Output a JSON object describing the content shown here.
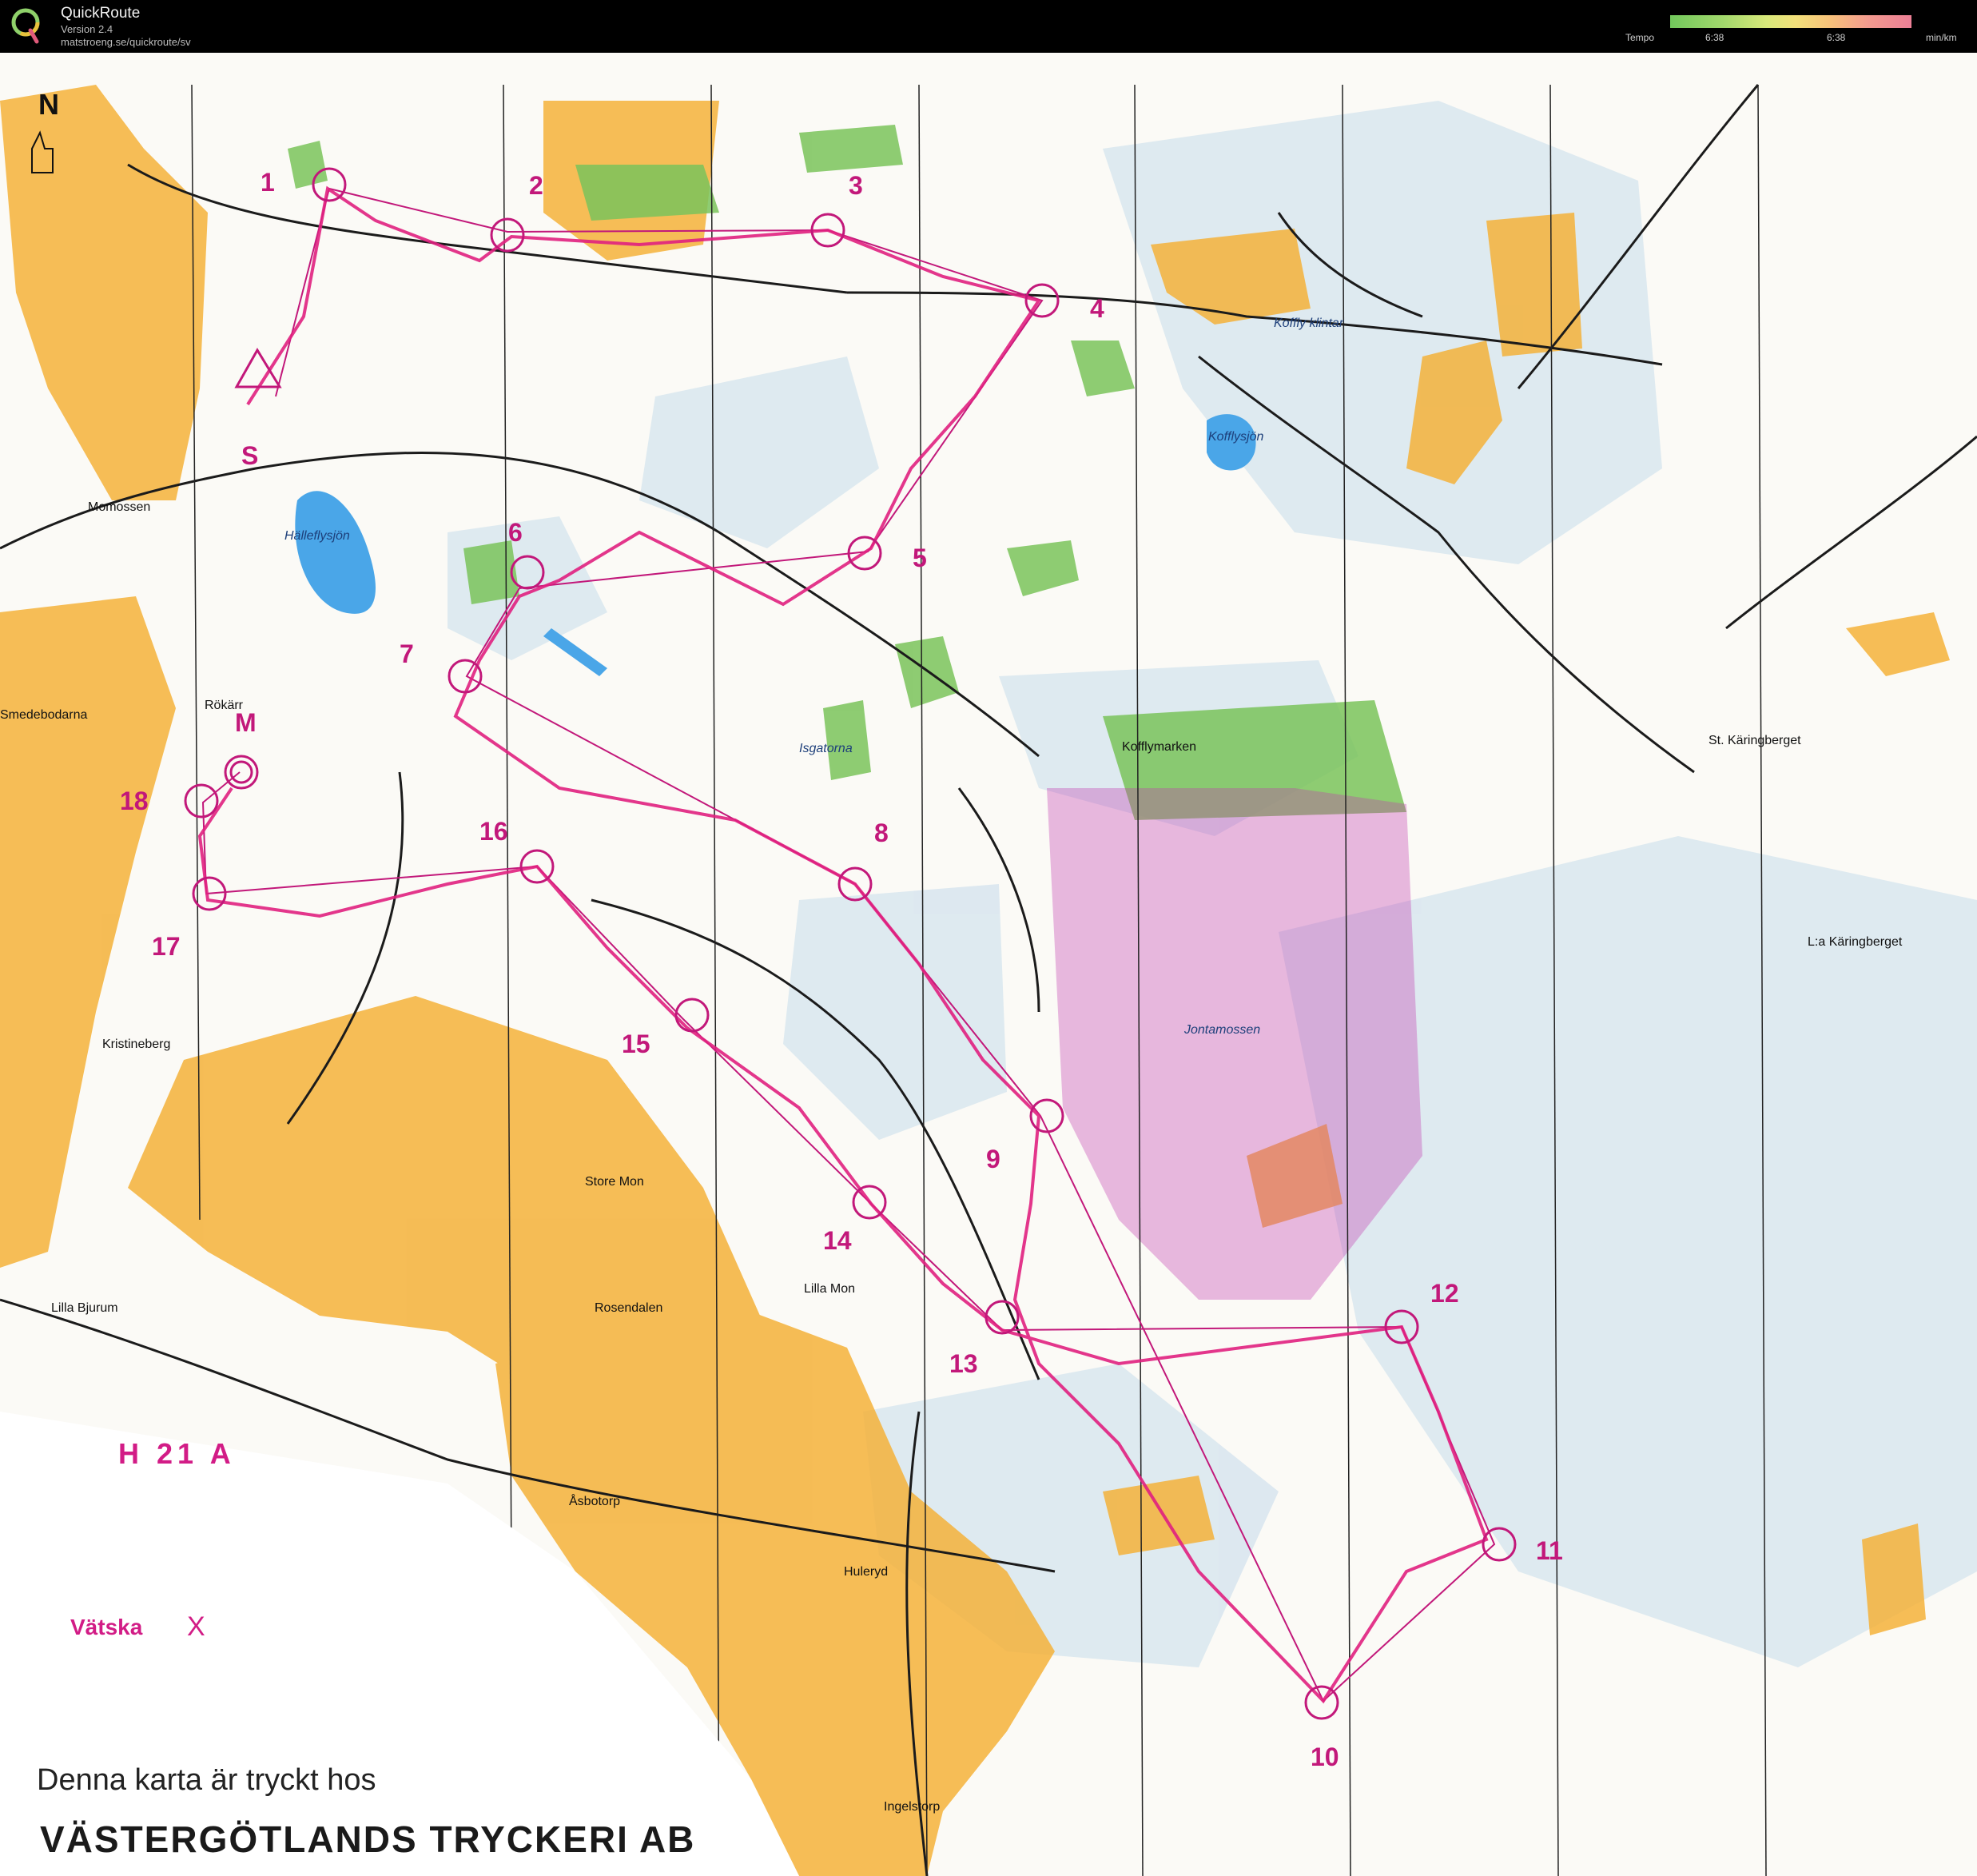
{
  "app": {
    "title": "QuickRoute",
    "version": "Version 2.4",
    "url": "matstroeng.se/quickroute/sv",
    "logo_icon": "quickroute-q-logo-icon"
  },
  "tempo_scale": {
    "label": "Tempo",
    "min_value": "6:38",
    "max_value": "6:38",
    "unit": "min/km",
    "colors": [
      "#72c85c",
      "#d8e87a",
      "#f7c27a",
      "#ec7f96"
    ]
  },
  "map": {
    "north_label": "N",
    "class_label": "H 21 A",
    "drink_station_label": "Vätska",
    "drink_station_mark": "X",
    "printer_line": "Denna karta är tryckt hos",
    "printer_name": "VÄSTERGÖTLANDS TRYCKERI AB",
    "start_label": "S",
    "finish_label": "M",
    "course_color": "#c2187a",
    "route_color": "#e0207f",
    "place_names": [
      "Momossen",
      "Hälleflysjön",
      "Smedebodarna",
      "Rökärr",
      "Kristineberg",
      "Store Mon",
      "Rosendalen",
      "Lilla Mon",
      "Lilla Bjurum",
      "Åsbotorp",
      "Huleryd",
      "Ingelstorp",
      "Isgatorna",
      "Koffly klintar",
      "Kofflysjön",
      "Kofflymarken",
      "Jontamossen",
      "St. Käringberget",
      "L:a Käringberget"
    ],
    "controls": [
      "1",
      "2",
      "3",
      "4",
      "5",
      "6",
      "7",
      "8",
      "9",
      "10",
      "11",
      "12",
      "13",
      "14",
      "15",
      "16",
      "17",
      "18"
    ]
  }
}
